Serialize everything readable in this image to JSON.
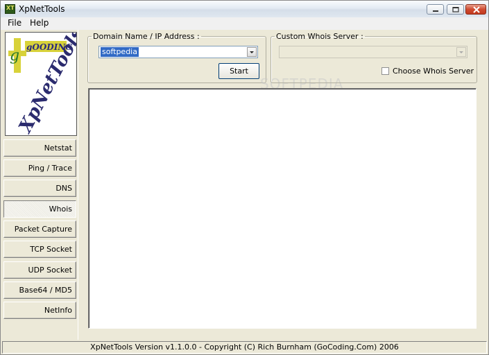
{
  "window": {
    "title": "XpNetTools",
    "icon_text": "XT"
  },
  "menu": [
    {
      "label": "File"
    },
    {
      "label": "Help"
    }
  ],
  "logo": {
    "brand_text": "gOODING",
    "product_text": "XpNetTools",
    "icon": "xpnettools-logo"
  },
  "nav": [
    {
      "label": "Netstat",
      "active": false
    },
    {
      "label": "Ping / Trace",
      "active": false
    },
    {
      "label": "DNS",
      "active": false
    },
    {
      "label": "Whois",
      "active": true
    },
    {
      "label": "Packet Capture",
      "active": false
    },
    {
      "label": "TCP Socket",
      "active": false
    },
    {
      "label": "UDP Socket",
      "active": false
    },
    {
      "label": "Base64 / MD5",
      "active": false
    },
    {
      "label": "NetInfo",
      "active": false
    }
  ],
  "domain_group": {
    "legend": "Domain Name / IP Address :",
    "value": "softpedia",
    "start_label": "Start"
  },
  "whois_group": {
    "legend": "Custom Whois Server :",
    "server_value": "",
    "checkbox_label": "Choose Whois Server",
    "checked": false
  },
  "watermark": "SOFTPEDIA",
  "status": {
    "text": "XpNetTools Version v1.1.0.0 - Copyright (C) Rich Burnham (GoCoding.Com) 2006"
  },
  "colors": {
    "accent": "#316ac5",
    "window_bg": "#ece9d8",
    "close": "#c23a1f"
  }
}
